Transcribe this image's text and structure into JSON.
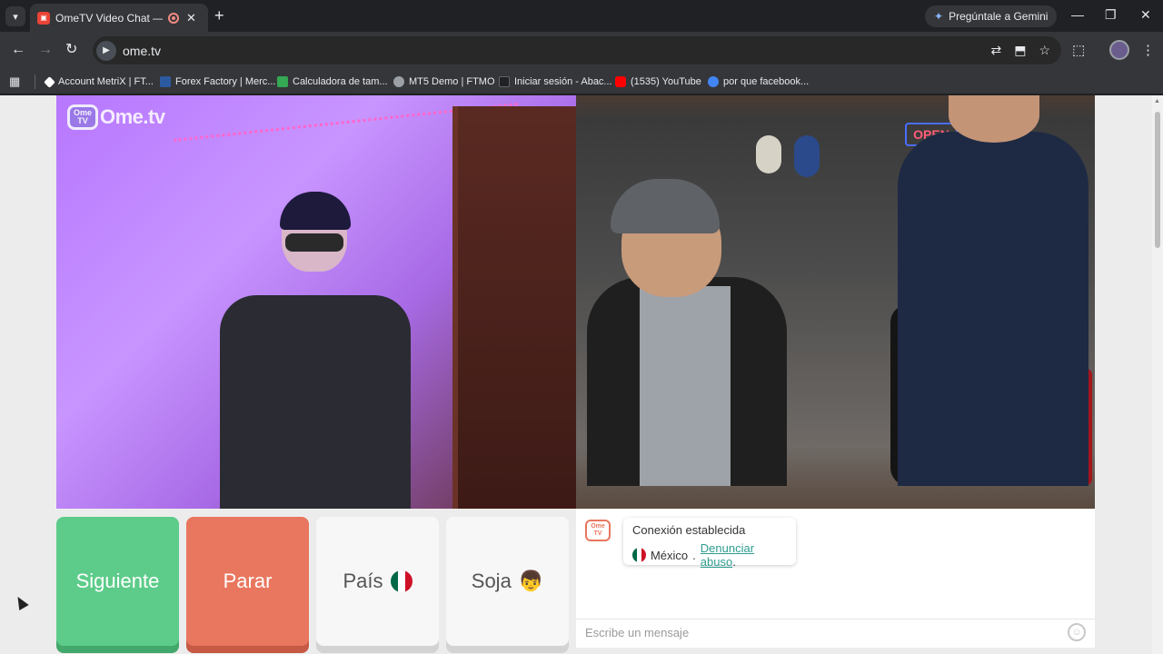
{
  "browser": {
    "tab": {
      "title": "OmeTV Video Chat — Alter"
    },
    "gemini_label": "Pregúntale a Gemini",
    "url": "ome.tv"
  },
  "bookmarks": [
    {
      "label": "Account MetriX | FT...",
      "color": "#ffffff"
    },
    {
      "label": "Forex Factory | Merc...",
      "color": "#2c5aa0"
    },
    {
      "label": "Calculadora de tam...",
      "color": "#34a853"
    },
    {
      "label": "MT5 Demo | FTMO",
      "color": "#9aa0a6"
    },
    {
      "label": "Iniciar sesión - Abac...",
      "color": "#202124"
    },
    {
      "label": "(1535) YouTube",
      "color": "#ff0000"
    },
    {
      "label": "por que facebook...",
      "color": "#4285f4"
    }
  ],
  "ometv": {
    "logo_text": "Ome.tv",
    "logo_box": [
      "Ome",
      "TV"
    ],
    "neon_sign": "OPEN",
    "buttons": {
      "next": "Siguiente",
      "stop": "Parar",
      "country": "País",
      "gender": "Soja"
    },
    "chat": {
      "status": "Conexión establecida",
      "country": "México",
      "separator": ".",
      "report_link": "Denunciar abuso",
      "report_suffix": ".",
      "input_placeholder": "Escribe un mensaje"
    }
  },
  "colors": {
    "next_button": "#5dcc8a",
    "stop_button": "#e9765e",
    "link": "#2e9c8f"
  }
}
